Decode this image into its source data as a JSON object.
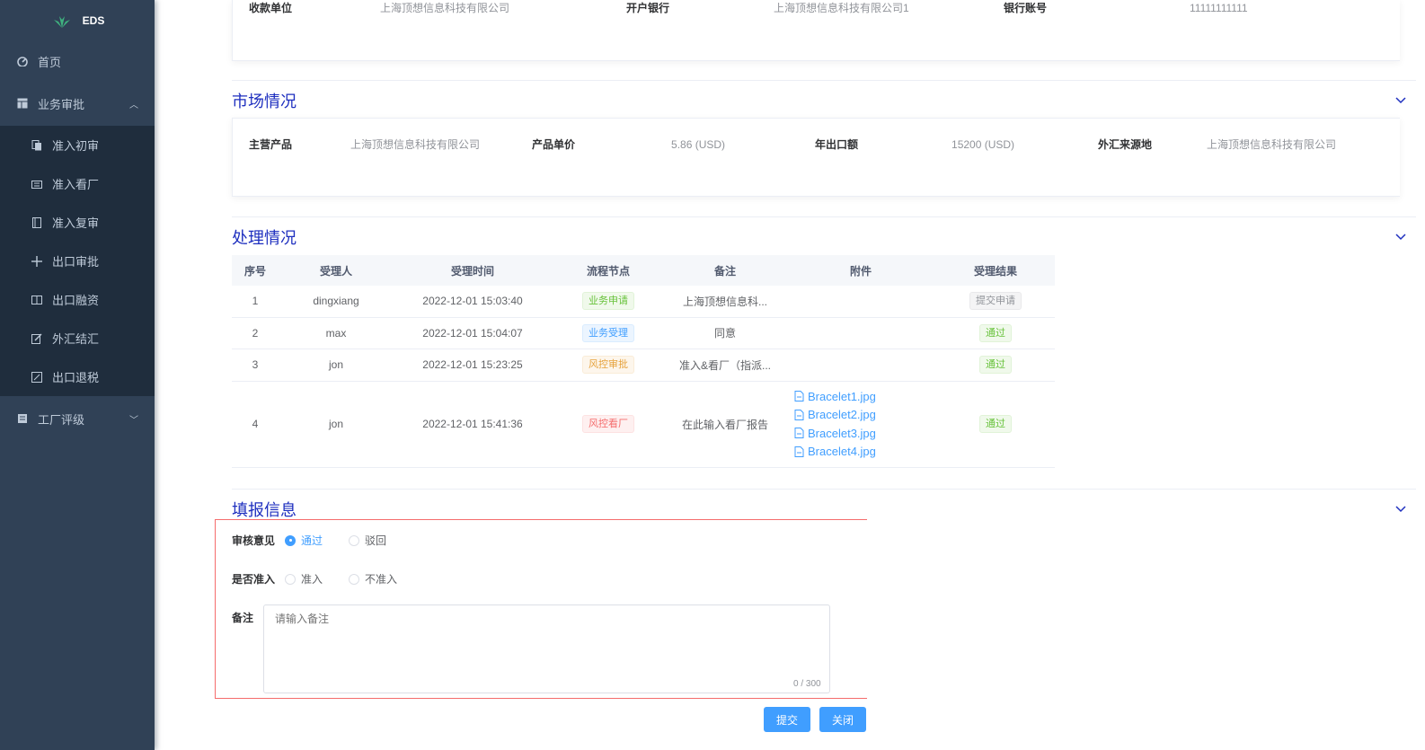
{
  "sidebar": {
    "logo_text": "EDS",
    "items": [
      {
        "label": "首页",
        "icon": "dashboard-icon"
      },
      {
        "label": "业务审批",
        "icon": "table-icon"
      },
      {
        "label": "准入初审",
        "icon": "copy-icon"
      },
      {
        "label": "准入看厂",
        "icon": "factory-icon"
      },
      {
        "label": "准入复审",
        "icon": "book-icon"
      },
      {
        "label": "出口审批",
        "icon": "move-icon"
      },
      {
        "label": "出口融资",
        "icon": "columns-icon"
      },
      {
        "label": "外汇结汇",
        "icon": "edit-icon"
      },
      {
        "label": "出口退税",
        "icon": "refund-icon"
      },
      {
        "label": "工厂评级",
        "icon": "rating-icon"
      }
    ]
  },
  "receipt": {
    "payee_label": "收款单位",
    "payee_value": "上海顶想信息科技有限公司",
    "bank_label": "开户银行",
    "bank_value": "上海顶想信息科技有限公司1",
    "account_label": "银行账号",
    "account_value": "11111111111"
  },
  "market": {
    "title": "市场情况",
    "product_label": "主营产品",
    "product_value": "上海顶想信息科技有限公司",
    "price_label": "产品单价",
    "price_value": "5.86 (USD)",
    "export_label": "年出口额",
    "export_value": "15200 (USD)",
    "fx_label": "外汇来源地",
    "fx_value": "上海顶想信息科技有限公司"
  },
  "process": {
    "title": "处理情况",
    "columns": [
      "序号",
      "受理人",
      "受理时间",
      "流程节点",
      "备注",
      "附件",
      "受理结果"
    ],
    "rows": [
      {
        "no": "1",
        "handler": "dingxiang",
        "time": "2022-12-01 15:03:40",
        "node": "业务申请",
        "node_color": "green",
        "remark": "上海顶想信息科...",
        "result": "提交申请",
        "result_color": "gray"
      },
      {
        "no": "2",
        "handler": "max",
        "time": "2022-12-01 15:04:07",
        "node": "业务受理",
        "node_color": "blue",
        "remark": "同意",
        "result": "通过",
        "result_color": "green"
      },
      {
        "no": "3",
        "handler": "jon",
        "time": "2022-12-01 15:23:25",
        "node": "风控审批",
        "node_color": "orange",
        "remark": "准入&看厂（指派...",
        "result": "通过",
        "result_color": "green"
      },
      {
        "no": "4",
        "handler": "jon",
        "time": "2022-12-01 15:41:36",
        "node": "风控看厂",
        "node_color": "red",
        "remark": "在此输入看厂报告",
        "result": "通过",
        "result_color": "green",
        "attachments": [
          "Bracelet1.jpg",
          "Bracelet2.jpg",
          "Bracelet3.jpg",
          "Bracelet4.jpg"
        ]
      }
    ]
  },
  "fill": {
    "title": "填报信息",
    "opinion_label": "审核意见",
    "opinion_options": [
      "通过",
      "驳回"
    ],
    "opinion_selected": "通过",
    "admit_label": "是否准入",
    "admit_options": [
      "准入",
      "不准入"
    ],
    "remark_label": "备注",
    "remark_placeholder": "请输入备注",
    "counter": "0 / 300"
  },
  "buttons": {
    "submit": "提交",
    "close": "关闭"
  },
  "colors": {
    "sidebar_bg": "#304156",
    "submenu_bg": "#1f2d3d",
    "accent": "#409eff",
    "title": "#1e2fbf",
    "error_border": "#f56c6c"
  }
}
